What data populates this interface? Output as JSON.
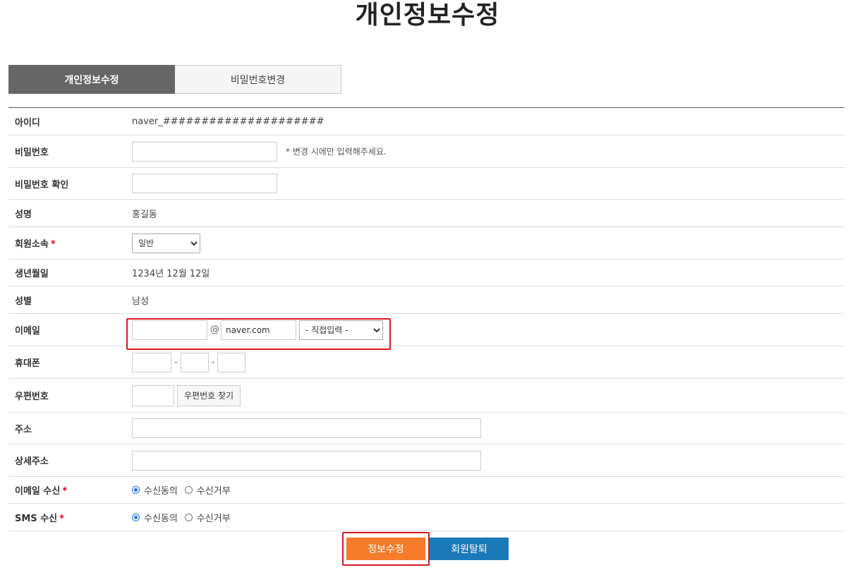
{
  "title": "개인정보수정",
  "tabs": [
    {
      "label": "개인정보수정",
      "active": true
    },
    {
      "label": "비밀번호변경",
      "active": false
    }
  ],
  "fields": {
    "userid": {
      "label": "아이디",
      "value": "naver_#####################"
    },
    "password": {
      "label": "비밀번호",
      "note": "* 변경 시에만 입력해주세요."
    },
    "password_confirm": {
      "label": "비밀번호 확인"
    },
    "name": {
      "label": "성명",
      "value": "홍길동"
    },
    "member_type": {
      "label": "회원소속",
      "selected": "일반"
    },
    "birth": {
      "label": "생년월일",
      "value": "1234년 12월 12일"
    },
    "gender": {
      "label": "성별",
      "value": "남성"
    },
    "email": {
      "label": "이메일",
      "at": "@",
      "domain": "naver.com",
      "domain_select": "- 직접입력 -"
    },
    "phone": {
      "label": "휴대폰",
      "sep": "-"
    },
    "zipcode": {
      "label": "우편번호",
      "button": "우편번호 찾기"
    },
    "address": {
      "label": "주소"
    },
    "address_detail": {
      "label": "상세주소"
    },
    "email_receive": {
      "label": "이메일 수신",
      "options": [
        "수신동의",
        "수신거부"
      ],
      "selected": 0
    },
    "sms_receive": {
      "label": "SMS 수신",
      "options": [
        "수신동의",
        "수신거부"
      ],
      "selected": 0
    }
  },
  "required_mark": "*",
  "buttons": {
    "update": "정보수정",
    "withdraw": "회원탈퇴"
  },
  "colors": {
    "accent_orange": "#f47c2a",
    "accent_blue": "#1a7ab8",
    "highlight_red": "#d71920",
    "tab_active": "#666666"
  }
}
